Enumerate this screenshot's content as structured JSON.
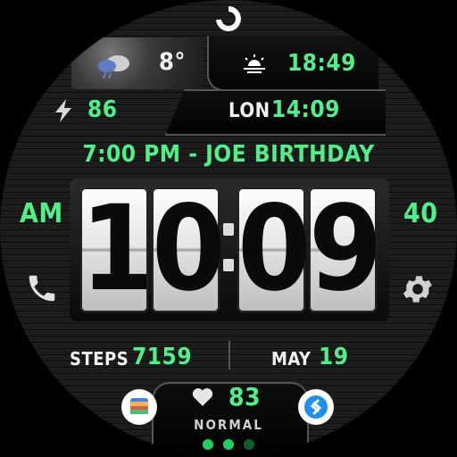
{
  "weather": {
    "temperature": "8°",
    "icon": "cloud-rain-icon"
  },
  "sunset": {
    "time": "18:49",
    "icon": "sunset-icon"
  },
  "battery": {
    "value": "86",
    "icon": "bolt-icon"
  },
  "world_clock": {
    "city": "LON",
    "time": "14:09"
  },
  "event": {
    "text": "7:00 PM - JOE BIRTHDAY"
  },
  "time": {
    "hour_tens": "1",
    "hour_ones": "0",
    "minute_tens": "0",
    "minute_ones": "9",
    "ampm": "AM",
    "seconds": "40"
  },
  "steps": {
    "label": "STEPS",
    "value": "7159"
  },
  "date": {
    "month": "MAY",
    "day": "19"
  },
  "heart": {
    "value": "83",
    "status": "NORMAL"
  },
  "colors": {
    "accent": "#4ef08a",
    "text": "#f2f2f2"
  }
}
